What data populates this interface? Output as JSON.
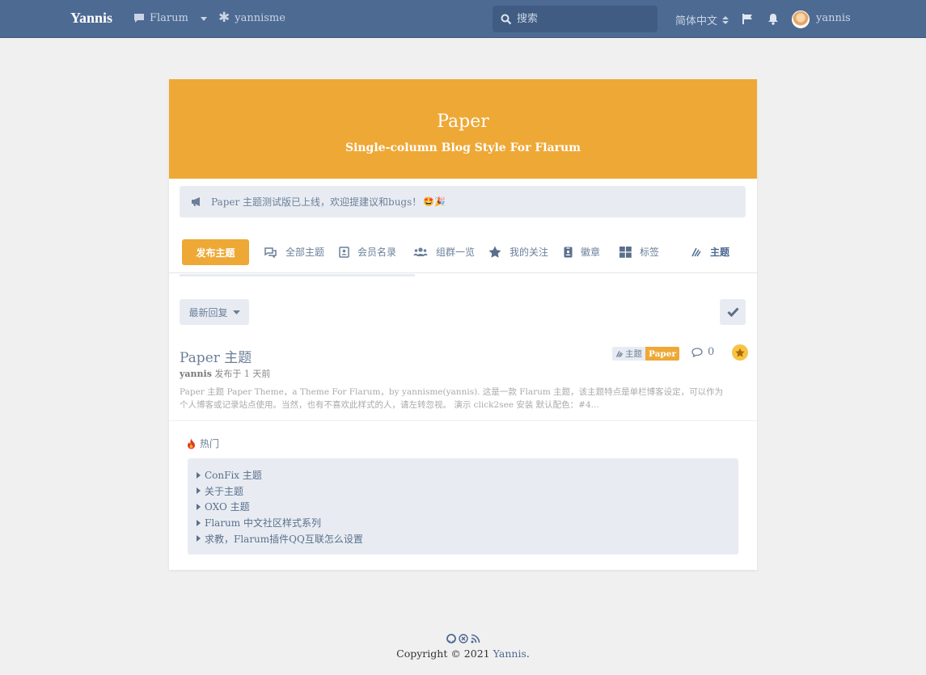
{
  "header": {
    "brand": "Yannis",
    "nav": [
      {
        "label": "Flarum",
        "icon": "comment-icon"
      },
      {
        "label": "yannisme",
        "icon": "asterisk-icon"
      }
    ],
    "search_placeholder": "搜索",
    "language": "简体中文",
    "username": "yannis"
  },
  "hero": {
    "title": "Paper",
    "subtitle": "Single-column Blog Style For Flarum"
  },
  "notice": {
    "text": "Paper 主题测试版已上线，欢迎提建议和bugs！",
    "emoji": "🤩🎉"
  },
  "toolbar": {
    "post_button": "发布主题",
    "links": [
      {
        "label": "全部主题",
        "icon": "comments-icon"
      },
      {
        "label": "会员名录",
        "icon": "address-book-icon"
      },
      {
        "label": "组群一览",
        "icon": "users-icon"
      },
      {
        "label": "我的关注",
        "icon": "star-icon"
      },
      {
        "label": "徽章",
        "icon": "id-badge-icon"
      },
      {
        "label": "标签",
        "icon": "th-large-icon"
      },
      {
        "label": "主题",
        "icon": "paint-icon",
        "active": true
      }
    ]
  },
  "list": {
    "sort_label": "最新回复"
  },
  "discussion": {
    "title": "Paper 主题",
    "author": "yannis",
    "meta": "发布于 1 天前",
    "excerpt": "Paper 主题 Paper Theme，a Theme For Flarum，by yannisme(yannis). 这是一款 Flarum 主题，该主题特点是单栏博客设定，可以作为个人博客或记录站点使用。当然，也有不喜欢此样式的人，请左转忽视。 演示 click2see 安装 默认配色：#4...",
    "tag_primary": "主题",
    "tag_secondary": "Paper",
    "reply_count": "0"
  },
  "hot": {
    "title": "热门",
    "items": [
      "ConFix 主题",
      "关于主题",
      "OXO 主题",
      "Flarum 中文社区样式系列",
      "求教，Flarum插件QQ互联怎么设置"
    ]
  },
  "footer": {
    "copyright": "Copyright © 2021",
    "link": "Yannis",
    "period": "."
  },
  "colors": {
    "header": "#4d6a92",
    "accent": "#eea836",
    "panel": "#e8ecf2"
  }
}
